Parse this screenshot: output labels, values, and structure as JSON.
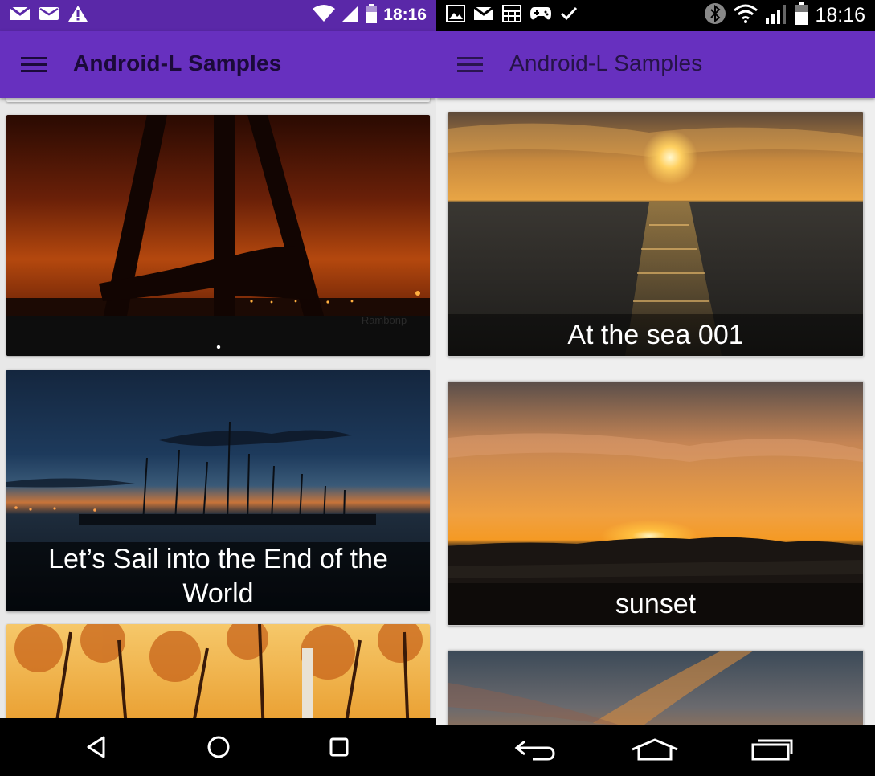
{
  "left": {
    "status": {
      "time": "18:16"
    },
    "toolbar": {
      "title": "Android-L Samples"
    },
    "cards": [
      {
        "caption": ""
      },
      {
        "caption": "Let’s Sail into the End of the World"
      },
      {
        "caption": ""
      }
    ],
    "watermark": "Rambonp",
    "nav": {
      "back": "back-icon",
      "home": "home-icon",
      "recents": "recents-icon"
    }
  },
  "right": {
    "status": {
      "time": "18:16"
    },
    "toolbar": {
      "title": "Android-L Samples"
    },
    "cards": [
      {
        "caption": "At the sea 001"
      },
      {
        "caption": "sunset"
      },
      {
        "caption": ""
      }
    ]
  },
  "colors": {
    "toolbar": "#6730bf",
    "statusbar_left": "#5a28a8"
  }
}
